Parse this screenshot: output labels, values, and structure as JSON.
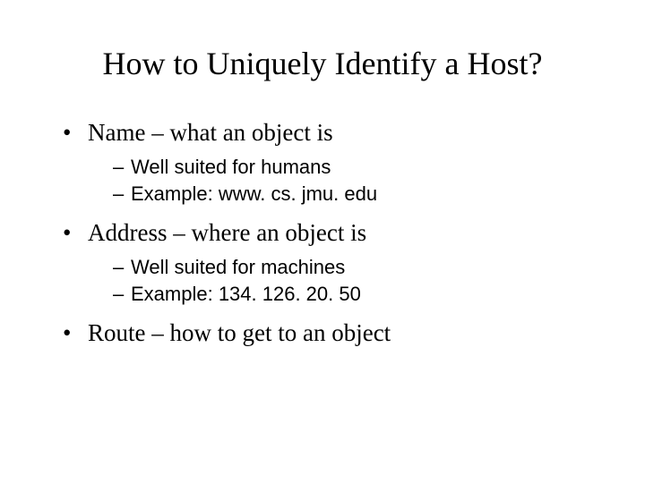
{
  "title": "How to Uniquely Identify a Host?",
  "bullets": [
    {
      "text": "Name – what an object is",
      "sub": [
        "Well suited for humans",
        "Example: www. cs. jmu. edu"
      ]
    },
    {
      "text": "Address – where an object is",
      "sub": [
        "Well suited for machines",
        "Example: 134. 126. 20. 50"
      ]
    },
    {
      "text": "Route – how to get to an object",
      "sub": []
    }
  ]
}
